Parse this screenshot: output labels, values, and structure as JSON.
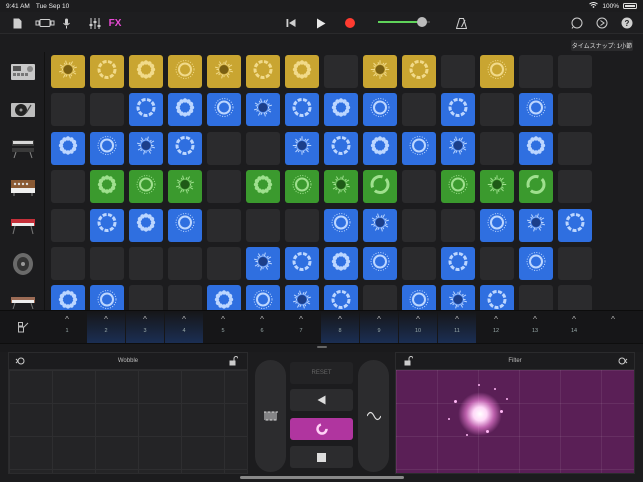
{
  "status": {
    "time": "9:41 AM",
    "date": "Tue Sep 10",
    "battery": "100%"
  },
  "toolbar": {
    "fx_label": "FX",
    "icons": [
      "document-icon",
      "view-switch-icon",
      "mic-icon",
      "mixer-icon",
      "rewind-icon",
      "play-icon",
      "record-icon",
      "metronome-icon",
      "loop-icon",
      "settings-icon",
      "help-icon"
    ],
    "volume_level": 0.85
  },
  "time_snap": "タイムスナップ: 1小節",
  "instruments": [
    {
      "name": "drum-machine"
    },
    {
      "name": "turntable"
    },
    {
      "name": "keyboard-stand"
    },
    {
      "name": "synthesizer"
    },
    {
      "name": "red-keyboard"
    },
    {
      "name": "bass-speaker"
    },
    {
      "name": "electric-piano"
    }
  ],
  "grid": {
    "rows": [
      [
        "y",
        "y",
        "y",
        "y",
        "y",
        "y",
        "y",
        "",
        "y",
        "y",
        "",
        "y",
        "",
        ""
      ],
      [
        "",
        "",
        "b",
        "b",
        "b",
        "b",
        "b",
        "b",
        "b",
        "",
        "b",
        "",
        "b",
        ""
      ],
      [
        "b",
        "b",
        "b",
        "b",
        "",
        "",
        "b",
        "b",
        "b",
        "b",
        "b",
        "",
        "b",
        ""
      ],
      [
        "",
        "g",
        "g",
        "g",
        "",
        "g",
        "g",
        "g",
        "g",
        "",
        "g",
        "g",
        "g",
        ""
      ],
      [
        "",
        "b",
        "b",
        "b",
        "",
        "",
        "",
        "b",
        "b",
        "",
        "",
        "b",
        "b",
        "b"
      ],
      [
        "",
        "",
        "",
        "",
        "",
        "b",
        "b",
        "b",
        "b",
        "",
        "b",
        "",
        "b",
        ""
      ],
      [
        "b",
        "b",
        "",
        "",
        "b",
        "b",
        "b",
        "b",
        "",
        "b",
        "b",
        "b",
        "",
        ""
      ]
    ]
  },
  "columns": [
    "1",
    "2",
    "3",
    "4",
    "5",
    "6",
    "7",
    "8",
    "9",
    "10",
    "11",
    "12",
    "13",
    "14",
    ""
  ],
  "fx": {
    "left_title": "Wobble",
    "right_title": "Filter",
    "reset_label": "RESET"
  }
}
